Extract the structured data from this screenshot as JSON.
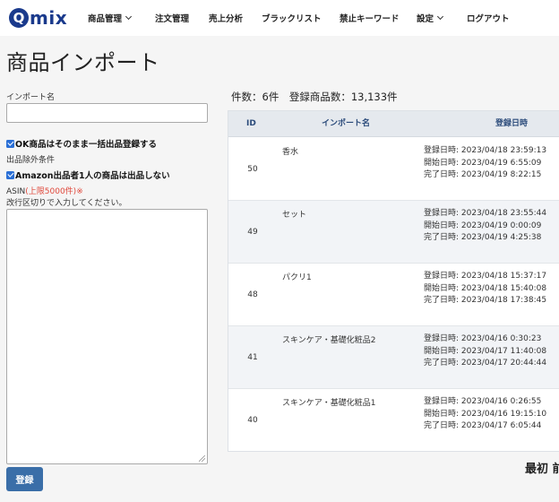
{
  "header": {
    "logo_q": "Q",
    "logo_rest": "mix",
    "nav": [
      {
        "label": "商品管理",
        "dropdown": true
      },
      {
        "label": "注文管理",
        "dropdown": false
      },
      {
        "label": "売上分析",
        "dropdown": false
      },
      {
        "label": "ブラックリスト",
        "dropdown": false
      },
      {
        "label": "禁止キーワード",
        "dropdown": false
      },
      {
        "label": "設定",
        "dropdown": true
      },
      {
        "label": "ログアウト",
        "dropdown": false
      }
    ]
  },
  "page_title": "商品インポート",
  "form": {
    "import_name_label": "インポート名",
    "import_name_value": "",
    "ok_check_label": "OK商品はそのまま一括出品登録する",
    "ok_checked": true,
    "exclusion_label": "出品除外条件",
    "amazon_check_label": "Amazon出品者1人の商品は出品しない",
    "amazon_checked": true,
    "asin_label": "ASIN",
    "asin_limit": "(上限5000件)※",
    "asin_hint": "改行区切りで入力してください。",
    "submit_label": "登録"
  },
  "summary": "件数：6件　登録商品数：13,133件",
  "table": {
    "headers": {
      "id": "ID",
      "name": "インポート名",
      "date": "登録日時"
    },
    "rows": [
      {
        "id": "50",
        "name": "香水",
        "registered": "登録日時: 2023/04/18 23:59:13",
        "started": "開始日時: 2023/04/19 6:55:09",
        "completed": "完了日時: 2023/04/19 8:22:15"
      },
      {
        "id": "49",
        "name": "セット",
        "registered": "登録日時: 2023/04/18 23:55:44",
        "started": "開始日時: 2023/04/19 0:00:09",
        "completed": "完了日時: 2023/04/19 4:25:38"
      },
      {
        "id": "48",
        "name": "パクリ1",
        "registered": "登録日時: 2023/04/18 15:37:17",
        "started": "開始日時: 2023/04/18 15:40:08",
        "completed": "完了日時: 2023/04/18 17:38:45"
      },
      {
        "id": "41",
        "name": "スキンケア・基礎化粧品2",
        "registered": "登録日時: 2023/04/16 0:30:23",
        "started": "開始日時: 2023/04/17 11:40:08",
        "completed": "完了日時: 2023/04/17 20:44:44"
      },
      {
        "id": "40",
        "name": "スキンケア・基礎化粧品1",
        "registered": "登録日時: 2023/04/16 0:26:55",
        "started": "開始日時: 2023/04/16 19:15:10",
        "completed": "完了日時: 2023/04/17 6:05:44"
      }
    ]
  },
  "pager": {
    "first": "最初",
    "next_partial": "前"
  }
}
